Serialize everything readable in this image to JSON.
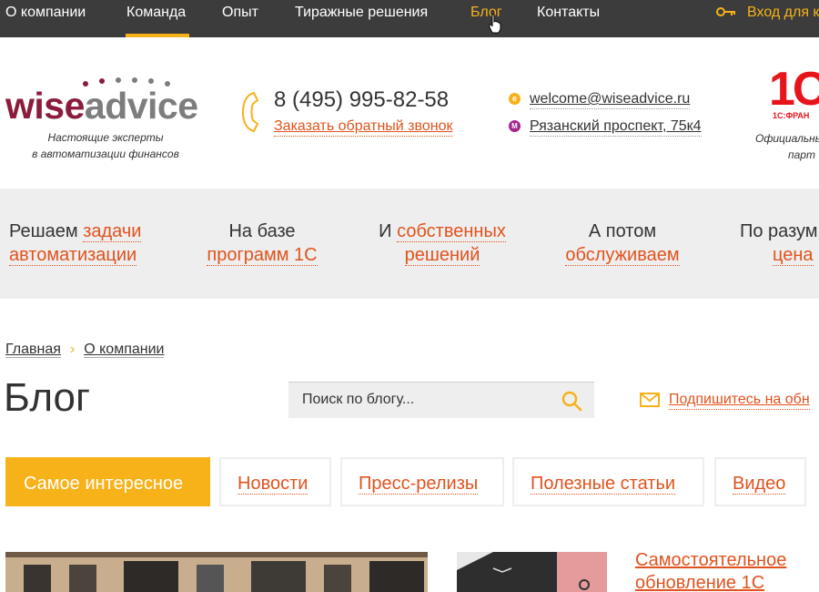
{
  "topnav": {
    "items": [
      {
        "label": "О компании"
      },
      {
        "label": "Команда"
      },
      {
        "label": "Опыт"
      },
      {
        "label": "Тиражные решения"
      },
      {
        "label": "Блог"
      },
      {
        "label": "Контакты"
      }
    ],
    "login_label": "Вход для к",
    "active_item": "Блог",
    "colors": {
      "bar": "#3c3c3c",
      "accent": "#f7b21a"
    }
  },
  "header": {
    "logo": {
      "part1": "wise",
      "part2": "advice"
    },
    "tagline": [
      "Настоящие эксперты",
      "в автоматизации финансов"
    ],
    "phone": "8 (495) 995-82-58",
    "callback": "Заказать обратный звонок",
    "email": "welcome@wiseadvice.ru",
    "address": "Рязанский проспект, 75к4",
    "email_badge": "e",
    "metro_badge": "M",
    "partner": {
      "logo": "1С",
      "sub": "1С:ФРАН",
      "caption": [
        "Официальны",
        "парт"
      ]
    }
  },
  "band": {
    "items": [
      {
        "line1_plain": "Решаем ",
        "line1_hl": "задачи",
        "line2_hl": "автоматизации"
      },
      {
        "line1_plain": "На базе",
        "line1_hl": "",
        "line2_hl": "программ 1С"
      },
      {
        "line1_plain": "И ",
        "line1_hl": "собственных",
        "line2_hl": "решений"
      },
      {
        "line1_plain": "А потом",
        "line1_hl": "",
        "line2_hl": "обслуживаем"
      },
      {
        "line1_plain": "По разум",
        "line1_hl": "",
        "line2_hl": "цена"
      }
    ]
  },
  "breadcrumb": {
    "home": "Главная",
    "current": "О компании",
    "separator": "›"
  },
  "page_title": "Блог",
  "search": {
    "placeholder": "Поиск по блогу...",
    "icon": "search-icon"
  },
  "subscribe": {
    "label": "Подпишитесь на обн",
    "icon": "envelope-icon"
  },
  "filters": [
    {
      "label": "Самое интересное",
      "active": true
    },
    {
      "label": "Новости"
    },
    {
      "label": "Пресс-релизы"
    },
    {
      "label": "Полезные статьи"
    },
    {
      "label": "Видео"
    }
  ],
  "article": {
    "title": "Самостоятельное обновление 1С"
  },
  "colors": {
    "accent_orange": "#e0531e",
    "accent_yellow": "#f7b21a",
    "band_bg": "#eeeeee",
    "brand_red": "#8b1c3b"
  }
}
